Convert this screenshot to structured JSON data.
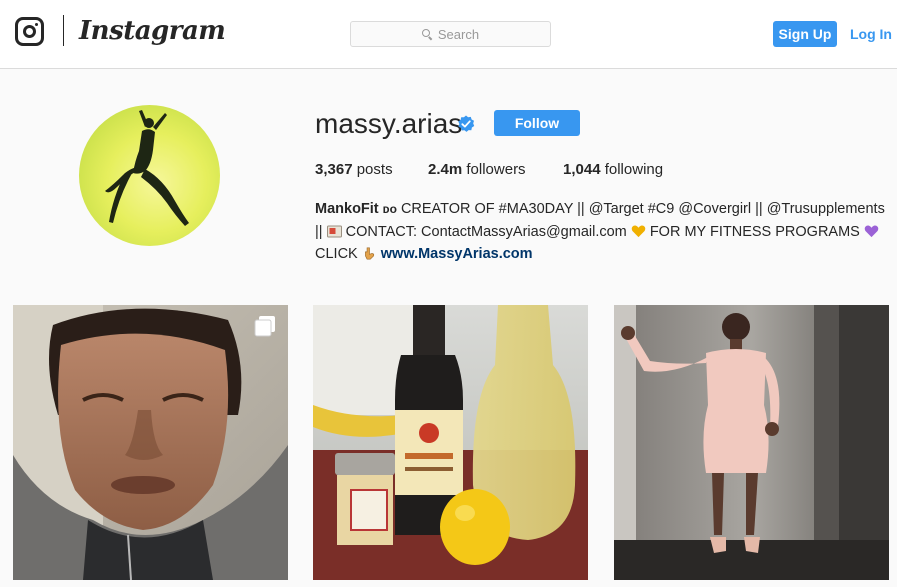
{
  "header": {
    "brand": "Instagram",
    "search_placeholder": "Search",
    "signup_label": "Sign Up",
    "login_label": "Log In",
    "accent_color": "#3897f0"
  },
  "profile": {
    "username": "massy.arias",
    "verified": true,
    "follow_label": "Follow",
    "stats": {
      "posts_count": "3,367",
      "posts_label": "posts",
      "followers_count": "2.4m",
      "followers_label": "followers",
      "following_count": "1,044",
      "following_label": "following"
    },
    "bio": {
      "name": "MankoFit",
      "name_suffix": "ᴅᴏ",
      "line1": "CREATOR OF #MA30DAY || @Target #C9 @Covergirl || @Trusupplements",
      "line2_prefix": "||",
      "line2_text": "CONTACT: ContactMassyArias@gmail.com",
      "line2_after": "FOR MY FITNESS PROGRAMS",
      "line3_text": "CLICK",
      "website": "www.MassyArias.com"
    }
  },
  "posts": [
    {
      "label": "selfie in grey hoodie",
      "multi": true
    },
    {
      "label": "apple cider vinegar, honey jar, lemon and juice jar",
      "multi": false
    },
    {
      "label": "woman in pink dress in elevator",
      "multi": false
    }
  ]
}
